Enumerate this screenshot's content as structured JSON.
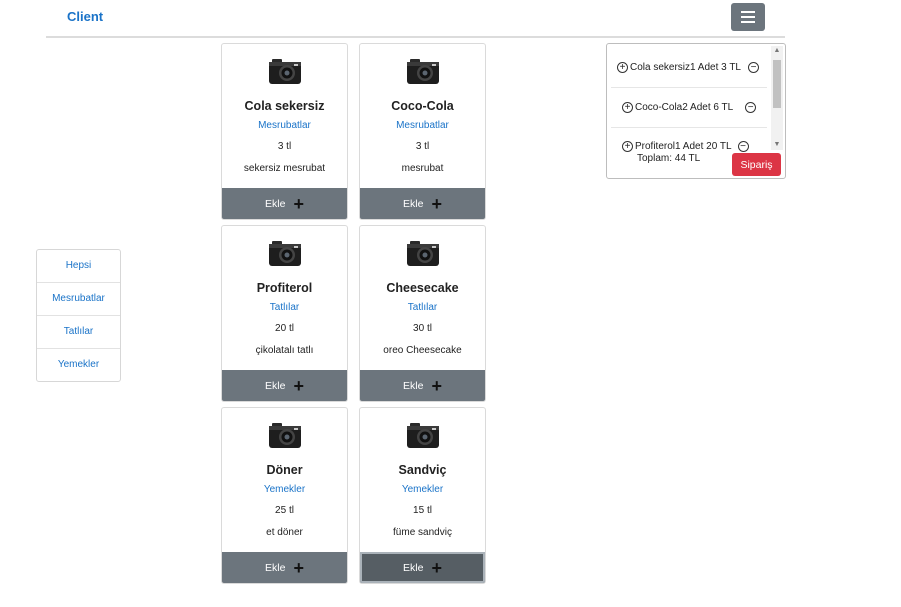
{
  "header": {
    "brand": "Client",
    "menu_icon": "hamburger-icon"
  },
  "categories": [
    "Hepsi",
    "Mesrubatlar",
    "Tatlılar",
    "Yemekler"
  ],
  "products": [
    {
      "name": "Cola sekersiz",
      "category": "Mesrubatlar",
      "price": "3 tl",
      "description": "sekersiz mesrubat",
      "button": "Ekle",
      "image_icon": "camera-icon"
    },
    {
      "name": "Coco-Cola",
      "category": "Mesrubatlar",
      "price": "3 tl",
      "description": "mesrubat",
      "button": "Ekle",
      "image_icon": "camera-icon"
    },
    {
      "name": "Profiterol",
      "category": "Tatlılar",
      "price": "20 tl",
      "description": "çikolatalı tatlı",
      "button": "Ekle",
      "image_icon": "camera-icon"
    },
    {
      "name": "Cheesecake",
      "category": "Tatlılar",
      "price": "30 tl",
      "description": "oreo Cheesecake",
      "button": "Ekle",
      "image_icon": "camera-icon"
    },
    {
      "name": "Döner",
      "category": "Yemekler",
      "price": "25 tl",
      "description": "et döner",
      "button": "Ekle",
      "image_icon": "camera-icon"
    },
    {
      "name": "Sandviç",
      "category": "Yemekler",
      "price": "15 tl",
      "description": "füme sandviç",
      "button": "Ekle",
      "image_icon": "camera-icon"
    }
  ],
  "cart": {
    "items": [
      {
        "text": "Cola sekersiz1 Adet 3 TL"
      },
      {
        "text": "Coco-Cola2 Adet 6 TL"
      },
      {
        "text": "Profiterol1 Adet 20 TL"
      }
    ],
    "total": "Toplam: 44 TL",
    "order_button": "Sipariş"
  },
  "colors": {
    "link": "#1a73c8",
    "button": "#6c757d",
    "order": "#dc3545"
  }
}
